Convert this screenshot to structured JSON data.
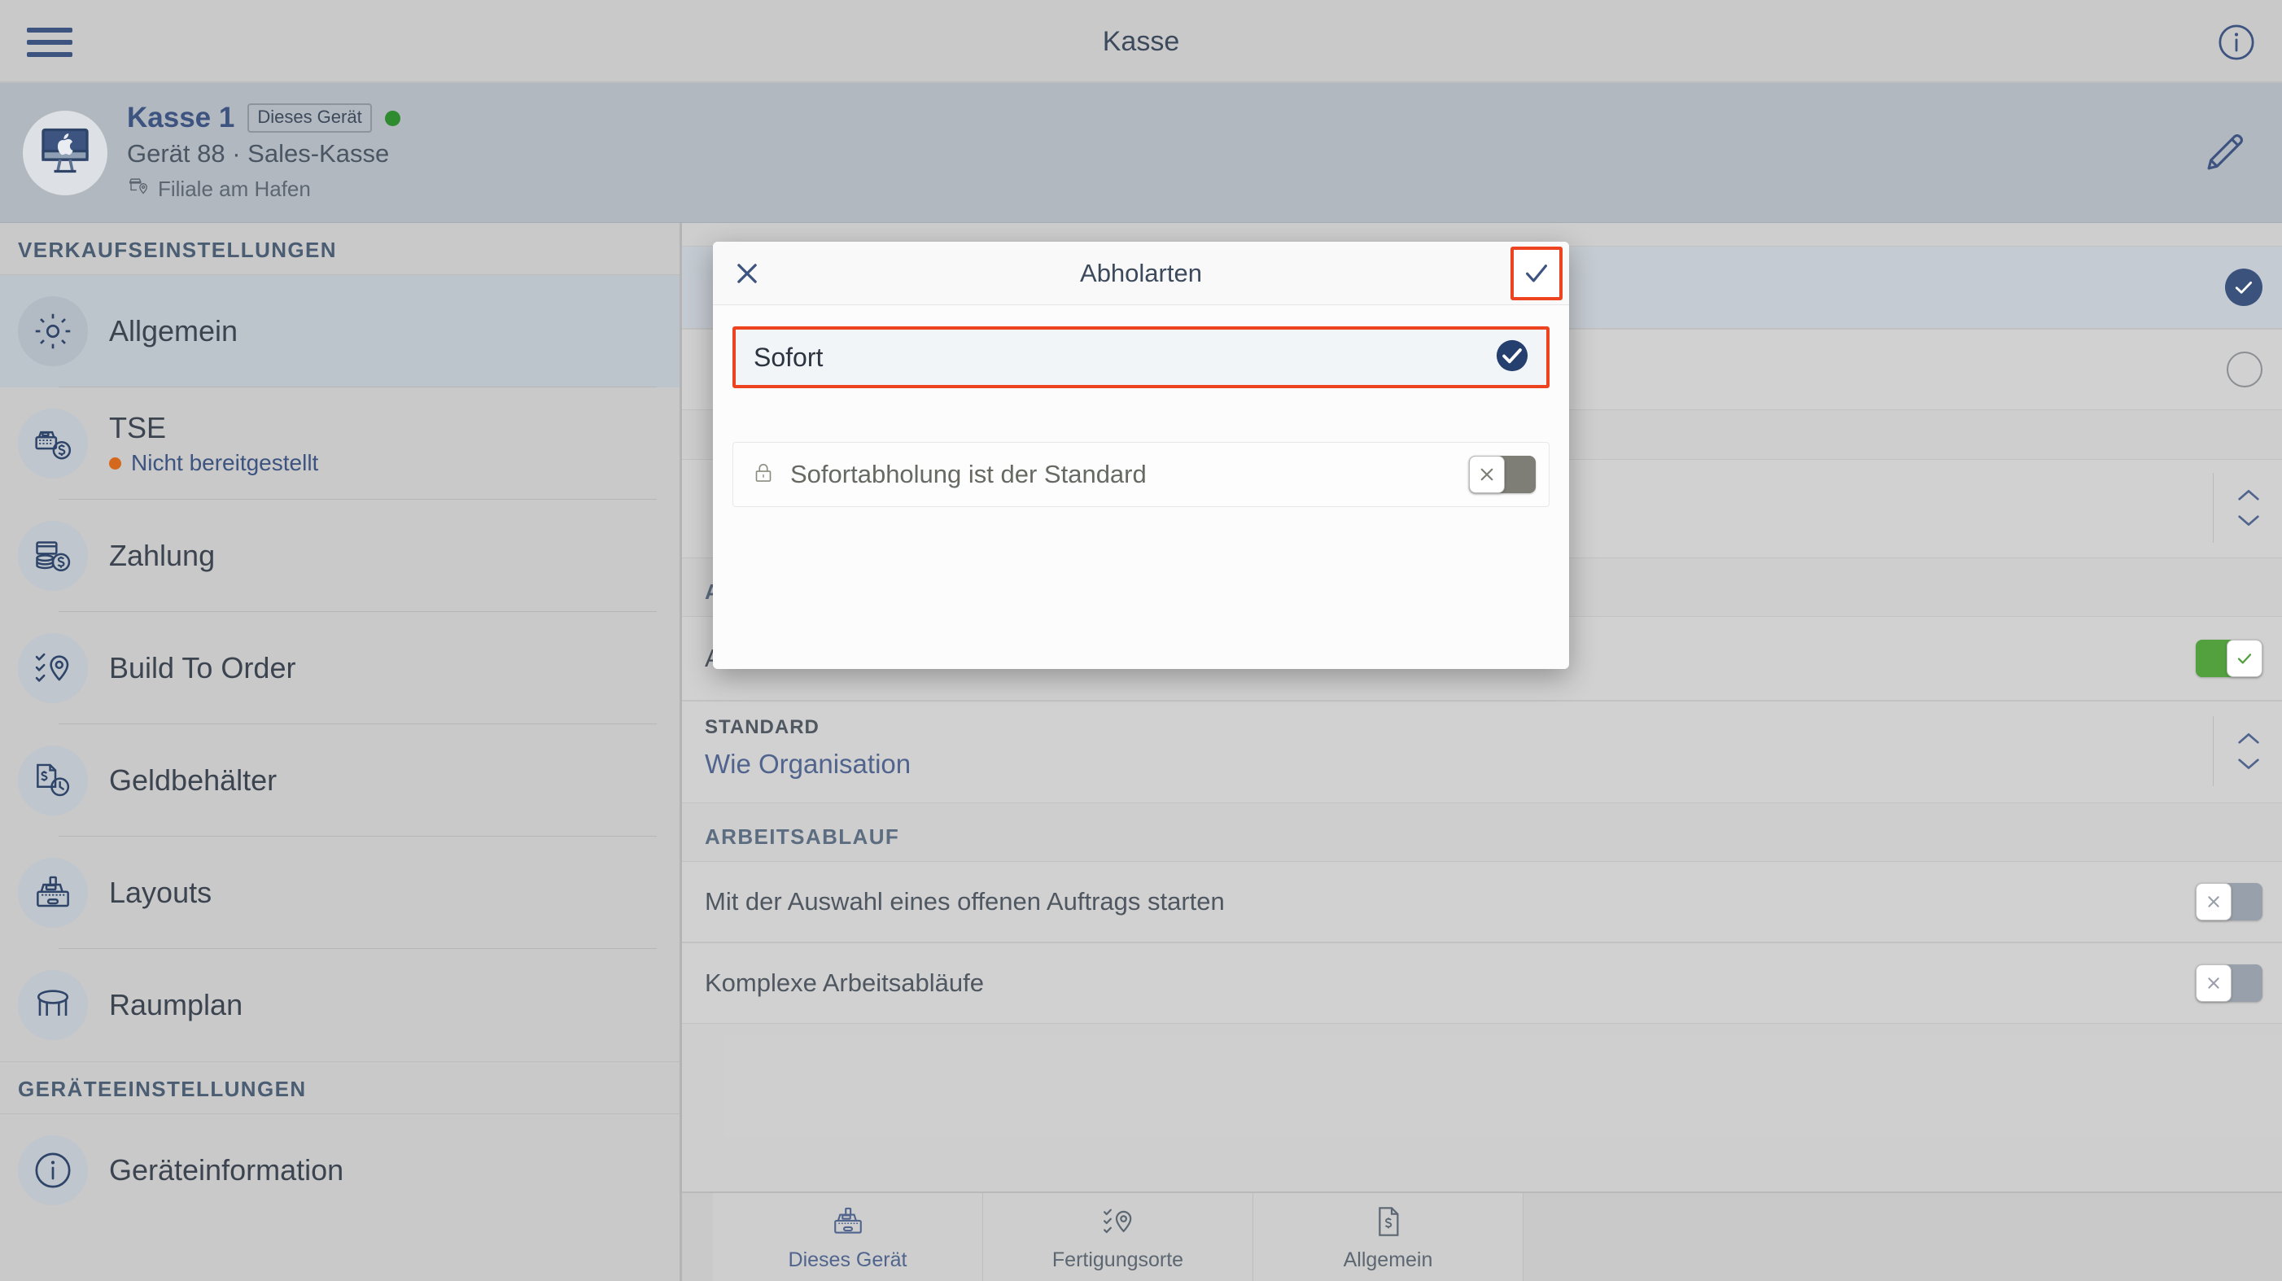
{
  "topbar": {
    "menu_icon": "hamburger-menu-icon",
    "title": "Kasse",
    "info_icon": "info-icon"
  },
  "device_header": {
    "avatar_icon": "imac-device-icon",
    "name": "Kasse 1",
    "badge": "Dieses Gerät",
    "status_dot_color": "#2f8b2f",
    "subtitle": "Gerät 88 · Sales-Kasse",
    "location_icon": "store-pin-icon",
    "location": "Filiale am Hafen",
    "edit_icon": "pencil-icon"
  },
  "sidebar": {
    "sections": [
      {
        "heading": "VERKAUFSEINSTELLUNGEN",
        "items": [
          {
            "label": "Allgemein",
            "icon": "gear-icon",
            "active": true,
            "sub": null
          },
          {
            "label": "TSE",
            "icon": "register-dollar-icon",
            "active": false,
            "sub": "Nicht bereitgestellt",
            "sub_dot_color": "#d4681c"
          },
          {
            "label": "Zahlung",
            "icon": "coins-card-icon",
            "active": false,
            "sub": null
          },
          {
            "label": "Build To Order",
            "icon": "checklist-pin-icon",
            "active": false,
            "sub": null
          },
          {
            "label": "Geldbehälter",
            "icon": "cash-document-clock-icon",
            "active": false,
            "sub": null
          },
          {
            "label": "Layouts",
            "icon": "cash-register-icon",
            "active": false,
            "sub": null
          },
          {
            "label": "Raumplan",
            "icon": "table-icon",
            "active": false,
            "sub": null
          }
        ]
      },
      {
        "heading": "GERÄTEEINSTELLUNGEN",
        "items": [
          {
            "label": "Geräteinformation",
            "icon": "info-circle-icon",
            "active": false,
            "sub": null
          }
        ]
      }
    ]
  },
  "content": {
    "pickup_rows": [
      {
        "label": "",
        "state": "selected"
      },
      {
        "label": "",
        "state": "unselected"
      }
    ],
    "order_type": {
      "heading": "AUFTRAGSART",
      "row_label": "Außer Haus",
      "toggle_state": "on",
      "standard_label": "STANDARD",
      "standard_value": "Wie Organisation",
      "stepper_icon": "chevron-updown-icon"
    },
    "workflow": {
      "heading": "ARBEITSABLAUF",
      "rows": [
        {
          "label": "Mit der Auswahl eines offenen Auftrags starten",
          "toggle_state": "off"
        },
        {
          "label": "Komplexe Arbeitsabläufe",
          "toggle_state": "off"
        }
      ]
    }
  },
  "modal": {
    "close_icon": "close-x-icon",
    "title": "Abholarten",
    "confirm_icon": "check-icon",
    "option": {
      "label": "Sofort",
      "selected": true,
      "check_icon": "check-circle-icon"
    },
    "sub_setting": {
      "lock_icon": "lock-icon",
      "label": "Sofortabholung ist der Standard",
      "toggle_state": "off",
      "toggle_icon": "x-icon"
    },
    "highlight_color": "#ee4321"
  },
  "tabbar": {
    "tabs": [
      {
        "label": "Dieses Gerät",
        "icon": "cash-register-icon",
        "active": true
      },
      {
        "label": "Fertigungsorte",
        "icon": "checklist-pin-icon",
        "active": false
      },
      {
        "label": "Allgemein",
        "icon": "document-dollar-icon",
        "active": false
      }
    ]
  }
}
